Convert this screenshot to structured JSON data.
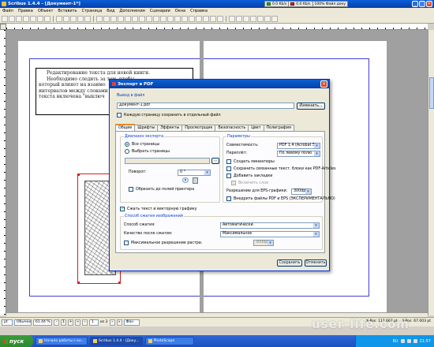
{
  "app": {
    "title": "Scribus 1.4.4 - [Документ-1*]",
    "menu": [
      "Файл",
      "Правка",
      "Объект",
      "Вставить",
      "Страница",
      "Вид",
      "Дополнения",
      "Сценарии",
      "Окна",
      "Справка"
    ],
    "net_meter": {
      "down": "0.0 Kb/s",
      "up": "0.0 Kb/s",
      "status": "100% Файл доку",
      "battery": "Нет доку"
    },
    "bottom": {
      "unit": "pt",
      "mode": "Обычно",
      "zoom": "61.44 %",
      "page_current": "1",
      "page_of": "из 2",
      "layer": "Фон",
      "xpos_label": "X-Pos:",
      "xpos": "117.667 pt",
      "ypos_label": "Y-Pos:",
      "ypos": "67.003 pt"
    }
  },
  "document": {
    "text_lines": [
      "Редактирование текста для новой книги.",
      "Необходимо следить за тем, чтобы",
      "который влияет на взаимо",
      "интервалов между словами",
      "текста включена \"выключ"
    ]
  },
  "dialog": {
    "title": "Экспорт в PDF",
    "output_label": "Вывод в файл",
    "file_name": "Документ-1.pdf",
    "change_button": "Изменить...",
    "per_page_label": "Каждую страницу сохранить в отдельный файл",
    "per_page_checked": false,
    "tabs": [
      "Общие",
      "Шрифты",
      "Эффекты",
      "Просмотрщик",
      "Безопасность",
      "Цвет",
      "Полиграфия"
    ],
    "active_tab": "Общие",
    "export_range_group": "Диапазон экспорта",
    "all_pages": "Все страницы",
    "choose_pages": "Выбрать страницы",
    "choose_pages_value": "",
    "rotation_label": "Поворот:",
    "rotation_value": "0 °",
    "clip_margins": "Обрезать до полей принтера",
    "params_group": "Параметры",
    "compat_label": "Совместимость:",
    "compat_value": "PDF 1.4 (Acrobat 5)",
    "binding_label": "Переплёт:",
    "binding_value": "По левому полю",
    "opt_thumbnails": "Создать миниатюры",
    "opt_linked_frames": "Сохранить связанные текст. блоки как PDF-Articles",
    "opt_bookmarks": "Добавить закладки",
    "opt_layers": "Включить слои",
    "eps_res_label": "Разрешение для EPS-графики:",
    "eps_res_value": "300dpi",
    "embed_eps": "Внедрить файлы PDF и EPS (ЭКСПЕРИМЕНТАЛЬНО)",
    "compress_text": "Сжать текст и векторную графику",
    "compression_group": "Способ сжатия изображений",
    "compress_method_label": "Способ сжатия:",
    "compress_method_value": "Автоматически",
    "quality_label": "Качество после сжатия:",
    "quality_value": "Максимальное",
    "max_res_label": "Максимальное разрешение растра:",
    "max_res_value": "300dpi",
    "save_button": "Сохранить",
    "cancel_button": "Отменить"
  },
  "taskbar": {
    "start": "пуск",
    "tasks": [
      "Начало работы с ко...",
      "Scribus 1.4.4 - [Доку...",
      "PhotoScape"
    ],
    "lang": "RU",
    "clock": "21:57"
  },
  "watermark": "user-life.com"
}
